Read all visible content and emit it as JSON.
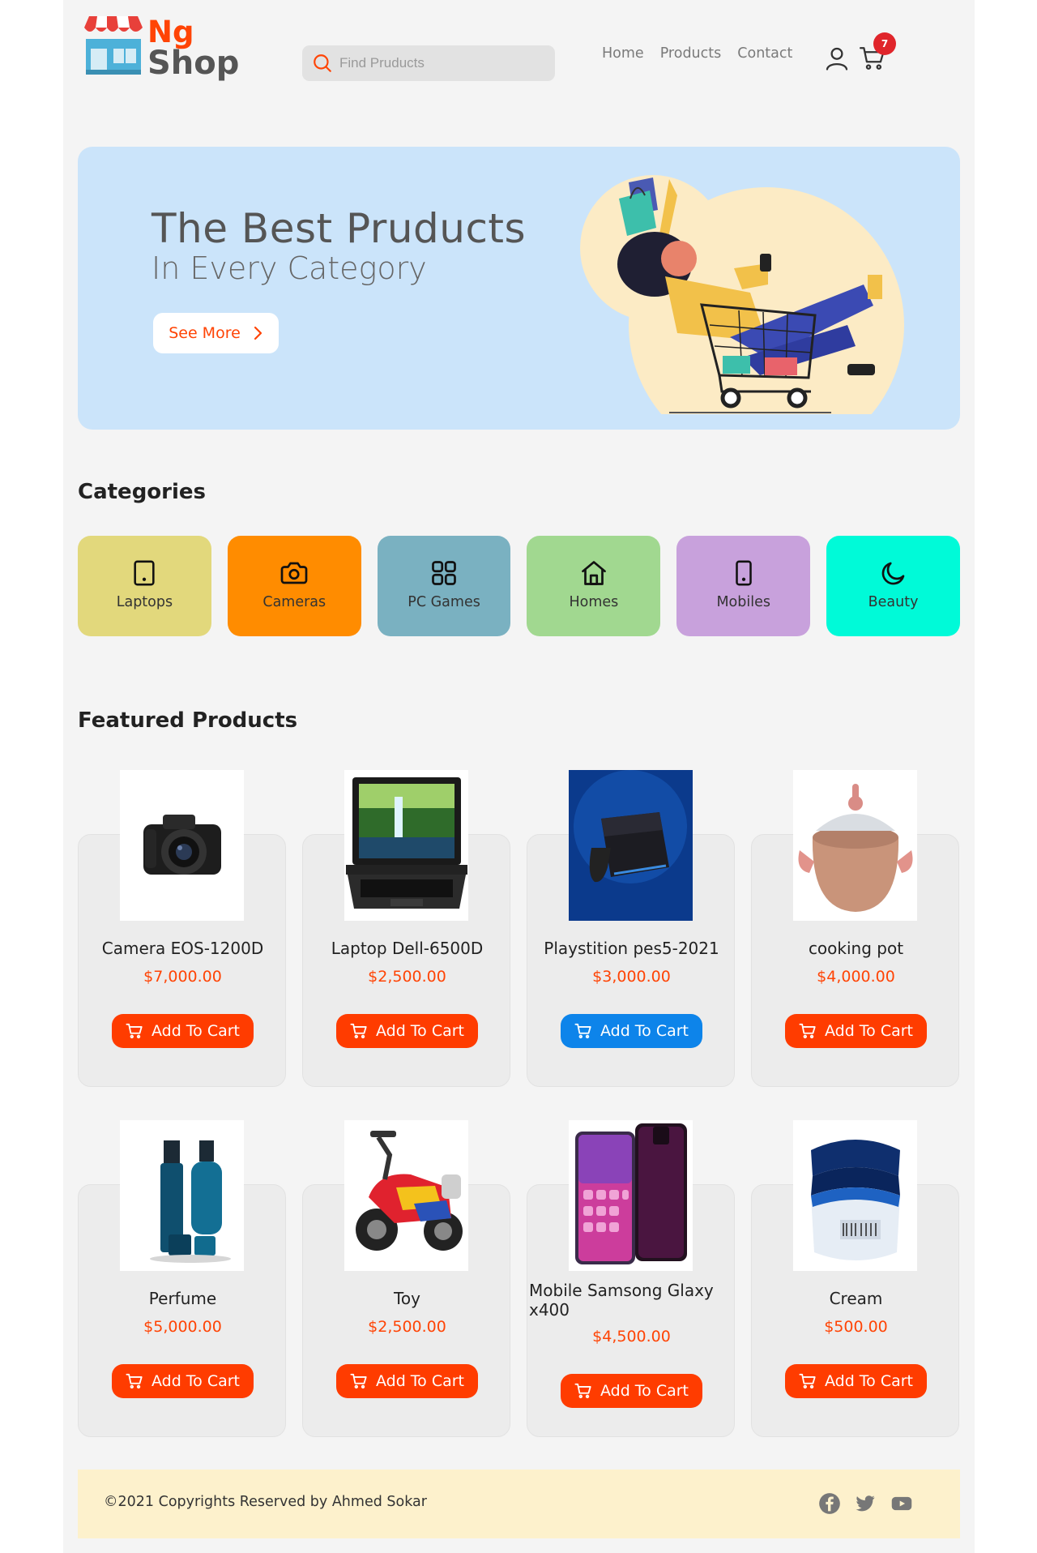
{
  "header": {
    "logo_top": "Ng",
    "logo_bottom": "Shop",
    "search_placeholder": "Find Pruducts",
    "nav": [
      "Home",
      "Products",
      "Contact"
    ],
    "cart_count": "7"
  },
  "hero": {
    "title": "The Best Pruducts",
    "subtitle": "In Every Category",
    "button": "See More",
    "bg_color": "#cbe4fa"
  },
  "categories": {
    "title": "Categories",
    "items": [
      {
        "label": "Laptops",
        "icon": "tablet-icon",
        "color": "#e2d87c"
      },
      {
        "label": "Cameras",
        "icon": "camera-icon",
        "color": "#ff8c00"
      },
      {
        "label": "PC Games",
        "icon": "grid-icon",
        "color": "#7ab1c1"
      },
      {
        "label": "Homes",
        "icon": "home-icon",
        "color": "#a1d890"
      },
      {
        "label": "Mobiles",
        "icon": "phone-icon",
        "color": "#c8a1dc"
      },
      {
        "label": "Beauty",
        "icon": "moon-icon",
        "color": "#00fad8"
      }
    ]
  },
  "featured": {
    "title": "Featured Products",
    "add_label": "Add To Cart",
    "products": [
      {
        "name": "Camera EOS-1200D",
        "price": "$7,000.00",
        "image": "camera-image"
      },
      {
        "name": "Laptop Dell-6500D",
        "price": "$2,500.00",
        "image": "laptop-image"
      },
      {
        "name": "Playstition pes5-2021",
        "price": "$3,000.00",
        "image": "console-image"
      },
      {
        "name": "cooking pot",
        "price": "$4,000.00",
        "image": "pot-image"
      },
      {
        "name": "Perfume",
        "price": "$5,000.00",
        "image": "perfume-image"
      },
      {
        "name": "Toy",
        "price": "$2,500.00",
        "image": "toy-image"
      },
      {
        "name": "Mobile Samsong Glaxy x400",
        "price": "$4,500.00",
        "image": "phone-image"
      },
      {
        "name": "Cream",
        "price": "$500.00",
        "image": "cream-image"
      }
    ]
  },
  "footer": {
    "copyright": "©2021 Copyrights Reserved by Ahmed Sokar",
    "social": [
      "facebook-icon",
      "twitter-icon",
      "youtube-icon"
    ]
  },
  "colors": {
    "accent": "#ff4405",
    "button": "#ff3c00",
    "button_active": "#0d84ea",
    "footer_bg": "#fdf1cc"
  }
}
